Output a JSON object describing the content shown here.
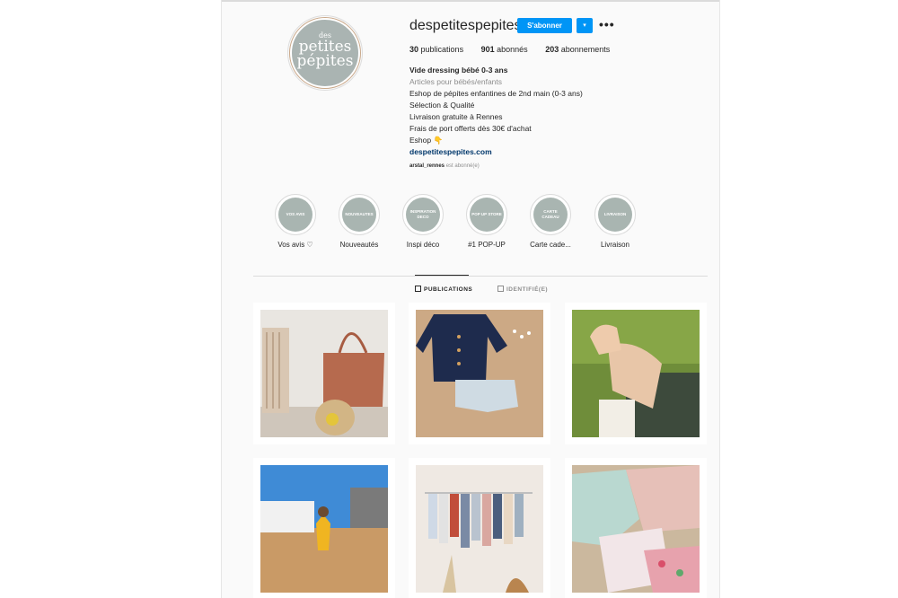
{
  "profile": {
    "username": "despetitespepites",
    "follow_label": "S'abonner",
    "dropdown_glyph": "▾",
    "more_glyph": "•••",
    "logo": {
      "line1": "des",
      "line2": "petites",
      "line3": "pépites"
    },
    "stats": {
      "posts_count": "30",
      "posts_label": "publications",
      "followers_count": "901",
      "followers_label": "abonnés",
      "following_count": "203",
      "following_label": "abonnements"
    },
    "bio": {
      "name": "Vide dressing bébé 0-3 ans",
      "category": "Articles pour bébés/enfants",
      "line1": "Eshop de pépites enfantines de 2nd main (0-3 ans)",
      "line2": "Sélection & Qualité",
      "line3": "Livraison gratuite à Rennes",
      "line4": "Frais de port offerts dès 30€ d'achat",
      "line5": "Eshop 👇",
      "website": "despetitespepites.com"
    },
    "followed_by_user": "arstal_rennes",
    "followed_by_suffix": " est abonné(e)"
  },
  "highlights": [
    {
      "inner": "VOS AVIS",
      "label": "Vos avis ♡"
    },
    {
      "inner": "NOUVEAUTES",
      "label": "Nouveautés"
    },
    {
      "inner": "INSPIRATION DECO",
      "label": "Inspi déco"
    },
    {
      "inner": "POP UP STORE",
      "label": "#1 POP-UP"
    },
    {
      "inner": "CARTE CADEAU",
      "label": "Carte cade..."
    },
    {
      "inner": "LIVRAISON",
      "label": "Livraison"
    }
  ],
  "tabs": {
    "posts": "PUBLICATIONS",
    "tagged": "IDENTIFIÉ(E)"
  },
  "icons": [
    "grid-icon",
    "tagged-icon",
    "more-icon",
    "dropdown-icon",
    "heart-icon"
  ],
  "colors": {
    "follow_blue": "#0095f6",
    "highlight_sage": "#a9b5b1",
    "link": "#00376b"
  }
}
